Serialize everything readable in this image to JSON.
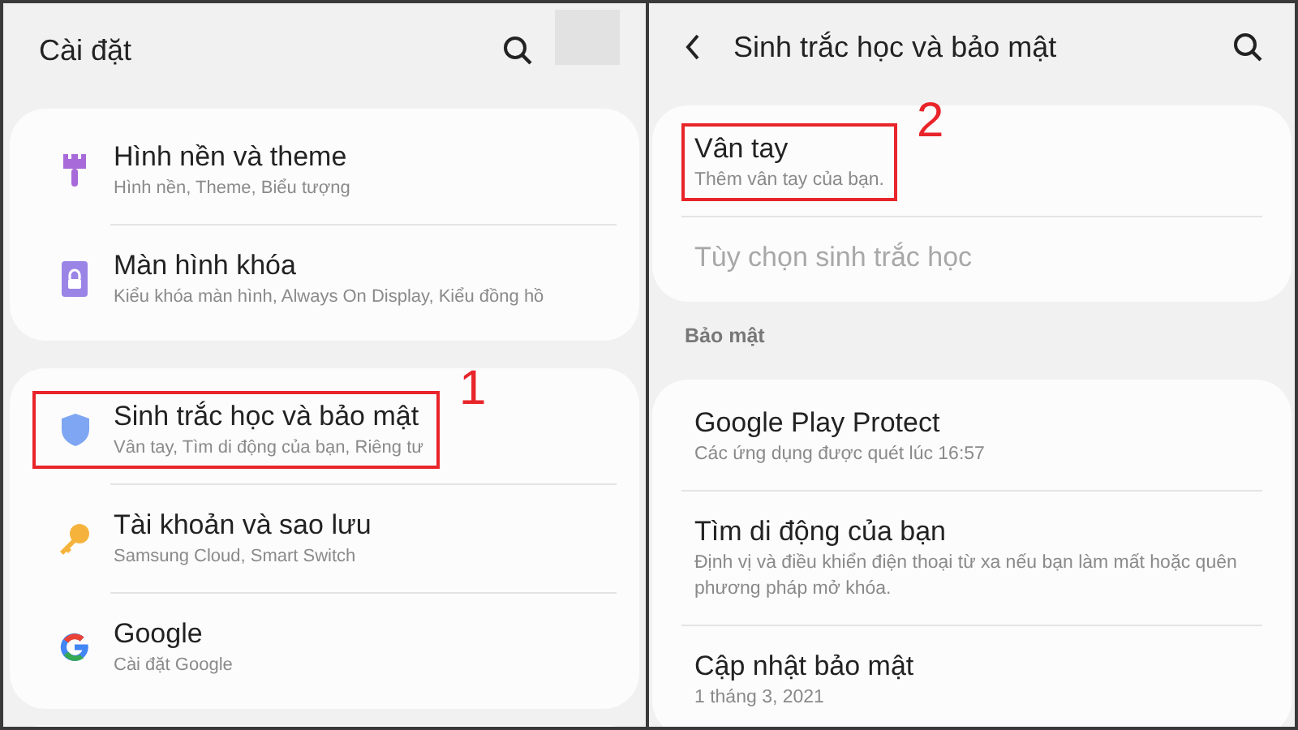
{
  "settings_screen": {
    "title": "Cài đặt",
    "groups": [
      {
        "items": [
          {
            "kind": "brush",
            "title": "Hình nền và theme",
            "subtitle": "Hình nền, Theme, Biểu tượng",
            "highlighted": false
          },
          {
            "kind": "lock",
            "title": "Màn hình khóa",
            "subtitle": "Kiểu khóa màn hình, Always On Display, Kiểu đồng hồ",
            "highlighted": false
          }
        ]
      },
      {
        "items": [
          {
            "kind": "shield",
            "title": "Sinh trắc học và bảo mật",
            "subtitle": "Vân tay, Tìm di động của bạn, Riêng tư",
            "highlighted": true,
            "step": "1"
          },
          {
            "kind": "key",
            "title": "Tài khoản và sao lưu",
            "subtitle": "Samsung Cloud, Smart Switch",
            "highlighted": false
          },
          {
            "kind": "google",
            "title": "Google",
            "subtitle": "Cài đặt Google",
            "highlighted": false
          }
        ]
      }
    ]
  },
  "security_screen": {
    "title": "Sinh trắc học và bảo mật",
    "groups": [
      {
        "items": [
          {
            "title": "Vân tay",
            "subtitle": "Thêm vân tay của bạn.",
            "highlighted": true,
            "step": "2",
            "disabled": false
          },
          {
            "title": "Tùy chọn sinh trắc học",
            "highlighted": false,
            "disabled": true
          }
        ]
      },
      {
        "header": "Bảo mật",
        "items": [
          {
            "title": "Google Play Protect",
            "subtitle": "Các ứng dụng được quét lúc 16:57",
            "highlighted": false,
            "disabled": false
          },
          {
            "title": "Tìm di động của bạn",
            "subtitle": "Định vị và điều khiển điện thoại từ xa nếu bạn làm mất hoặc quên phương pháp mở khóa.",
            "highlighted": false,
            "disabled": false
          },
          {
            "title": "Cập nhật bảo mật",
            "subtitle": "1 tháng 3, 2021",
            "highlighted": false,
            "disabled": false
          }
        ]
      }
    ]
  }
}
